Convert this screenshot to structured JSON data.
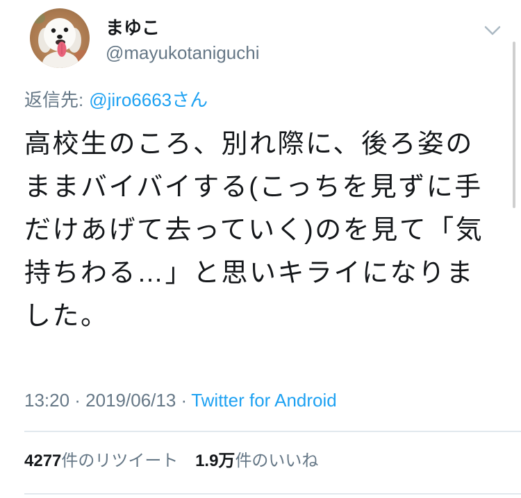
{
  "user": {
    "display_name": "まゆこ",
    "handle": "@mayukotaniguchi",
    "avatar_icon": "dog-photo-avatar"
  },
  "header": {
    "menu_icon": "chevron-down-icon"
  },
  "reply": {
    "label": "返信先:",
    "mention": "@jiro6663さん"
  },
  "tweet": {
    "body_lines": [
      "高校生のころ、別れ際に、後ろ姿の",
      "ままバイバイする(こっちを見ずに手",
      "だけあげて去っていく)のを見て「気",
      "持ちわる…」と思いキライになりま",
      "した。"
    ]
  },
  "meta": {
    "timestamp": "13:20 · 2019/06/13 ·",
    "source": "Twitter for Android"
  },
  "stats": {
    "retweets": {
      "count": "4277",
      "label": "件のリツイート"
    },
    "likes": {
      "count": "1.9万",
      "label": "件のいいね"
    }
  },
  "colors": {
    "text": "#14171a",
    "secondary": "#657786",
    "link": "#1da1f2",
    "divider": "#e1e8ed"
  }
}
